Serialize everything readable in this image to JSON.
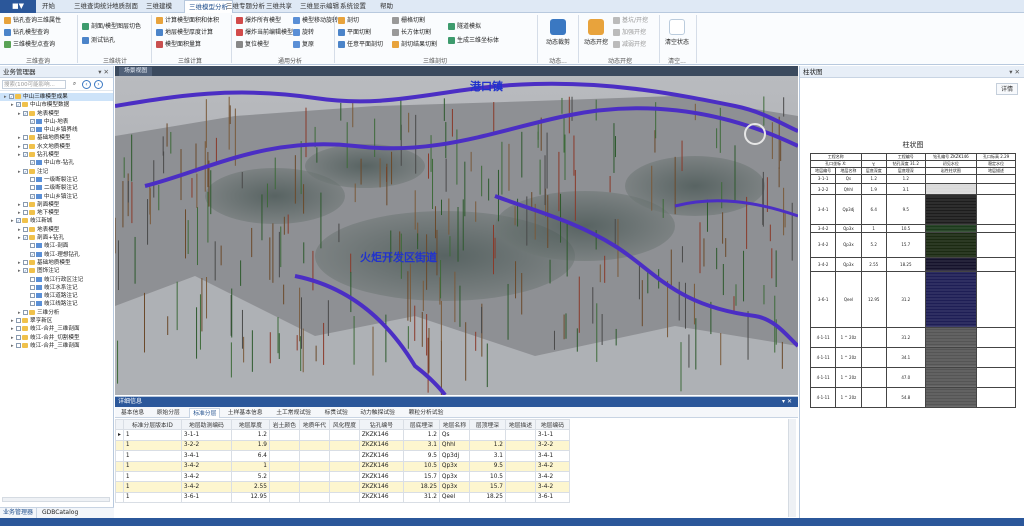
{
  "app": {
    "file_button": "■▼"
  },
  "ribbon_tabs": [
    "开始",
    "三维查询统计",
    "地质剖面",
    "三维建模",
    "三维模型分析",
    "三维专题分析",
    "三维共享",
    "三维显示编辑",
    "系统设置",
    "帮助"
  ],
  "ribbon_active_tab": "三维模型分析",
  "ribbon_groups": [
    {
      "name": "三维查询",
      "items": [
        "钻孔查询三维属性",
        "钻孔模型查询",
        "三维模型点查询"
      ]
    },
    {
      "name": "三维统计",
      "items": [
        "剖面/模型图层切色",
        "测试钻孔"
      ]
    },
    {
      "name": "三维计算",
      "items": [
        "计算模型面积和体积",
        "地层模型厚度计算",
        "模型面积量算"
      ]
    },
    {
      "name": "通用分析",
      "items": [
        "爆炸所有模型",
        "爆炸当前编辑模型",
        "复位模型",
        "模型移动旋转",
        "旋转",
        "复原"
      ]
    },
    {
      "name": "三维剖切",
      "items": [
        "剖切",
        "栅格切割",
        "隧道模拟",
        "平面切割",
        "长方体切割",
        "生成三维坐标体",
        "任意平面剖切",
        "剖切结果切割"
      ]
    },
    {
      "name": "动态...",
      "items": [
        "动态裁剪"
      ]
    },
    {
      "name": "动态开挖",
      "items": [
        "动态开挖",
        "基坑/开挖",
        "加强开挖",
        "减弱开挖"
      ]
    },
    {
      "name": "清空...",
      "items": [
        "清空状态"
      ]
    }
  ],
  "left_panel": {
    "title": "业务管理器",
    "search_placeholder": "搜索(100可能影响...",
    "footer_tabs": [
      "业务管理器",
      "GDBCatalog"
    ],
    "tree": [
      {
        "label": "中山三维模型成果",
        "level": 0,
        "type": "folder",
        "checked": true,
        "selected": true
      },
      {
        "label": "中山市模型数据",
        "level": 1,
        "type": "folder",
        "checked": true
      },
      {
        "label": "地表模型",
        "level": 2,
        "type": "folder",
        "checked": true
      },
      {
        "label": "中山-地表",
        "level": 3,
        "type": "layer",
        "checked": true
      },
      {
        "label": "中山乡镇界线",
        "level": 3,
        "type": "layer",
        "checked": true
      },
      {
        "label": "基础地质模型",
        "level": 2,
        "type": "folder",
        "checked": false
      },
      {
        "label": "水文地质模型",
        "level": 2,
        "type": "folder",
        "checked": false
      },
      {
        "label": "钻孔模型",
        "level": 2,
        "type": "folder",
        "checked": true
      },
      {
        "label": "中山市-钻孔",
        "level": 3,
        "type": "layer",
        "checked": true
      },
      {
        "label": "注记",
        "level": 2,
        "type": "folder",
        "checked": true
      },
      {
        "label": "一级断裂注记",
        "level": 3,
        "type": "layer",
        "checked": false
      },
      {
        "label": "二级断裂注记",
        "level": 3,
        "type": "layer",
        "checked": false
      },
      {
        "label": "中山乡镇注记",
        "level": 3,
        "type": "layer",
        "checked": true
      },
      {
        "label": "剖面模型",
        "level": 2,
        "type": "folder",
        "checked": false
      },
      {
        "label": "地下模型",
        "level": 2,
        "type": "folder",
        "checked": false
      },
      {
        "label": "岐江新城",
        "level": 1,
        "type": "folder",
        "checked": true
      },
      {
        "label": "地表模型",
        "level": 2,
        "type": "folder",
        "checked": false
      },
      {
        "label": "剖面+钻孔",
        "level": 2,
        "type": "folder",
        "checked": true
      },
      {
        "label": "岐江-剖面",
        "level": 3,
        "type": "layer",
        "checked": false
      },
      {
        "label": "岐江-理想钻孔",
        "level": 3,
        "type": "layer",
        "checked": true
      },
      {
        "label": "基础地质模型",
        "level": 2,
        "type": "folder",
        "checked": false
      },
      {
        "label": "图饰注记",
        "level": 2,
        "type": "folder",
        "checked": true
      },
      {
        "label": "岐江行政区注记",
        "level": 3,
        "type": "layer",
        "checked": false
      },
      {
        "label": "岐江水系注记",
        "level": 3,
        "type": "layer",
        "checked": false
      },
      {
        "label": "岐江道路注记",
        "level": 3,
        "type": "layer",
        "checked": false
      },
      {
        "label": "岐江线路注记",
        "level": 3,
        "type": "layer",
        "checked": false
      },
      {
        "label": "三维分析",
        "level": 2,
        "type": "folder",
        "checked": false
      },
      {
        "label": "翠亨新区",
        "level": 1,
        "type": "folder",
        "checked": false
      },
      {
        "label": "岐江-合并_三维剖面",
        "level": 1,
        "type": "folder",
        "checked": false
      },
      {
        "label": "岐江-合并_切割模型",
        "level": 1,
        "type": "folder",
        "checked": false
      },
      {
        "label": "岐江-合并_三维剖面",
        "level": 1,
        "type": "folder",
        "checked": false
      }
    ]
  },
  "viewport": {
    "tab_title": "场景视图",
    "labels": [
      {
        "text": "港口镇"
      },
      {
        "text": "火炬开发区街道"
      }
    ]
  },
  "detail": {
    "title": "详细信息",
    "tabs": [
      "基本信息",
      "原始分层",
      "标准分层",
      "土样基本信息",
      "土工常规试验",
      "标贯试验",
      "动力触探试验",
      "颗粒分析试验"
    ],
    "active_tab": "标准分层",
    "columns": [
      "标准分层版本ID",
      "地层助测编码",
      "地层厚度",
      "岩土颜色",
      "地质年代",
      "风化程度",
      "钻孔编号",
      "层底埋深",
      "地层名称",
      "层顶埋深",
      "地层描述",
      "地层编码"
    ],
    "rows": [
      [
        "1",
        "3-1-1",
        "1.2",
        "",
        "",
        "",
        "ZKZK146",
        "1.2",
        "Qs",
        "",
        "",
        "3-1-1"
      ],
      [
        "1",
        "3-2-2",
        "1.9",
        "",
        "",
        "",
        "ZKZK146",
        "3.1",
        "Qhhl",
        "1.2",
        "",
        "3-2-2"
      ],
      [
        "1",
        "3-4-1",
        "6.4",
        "",
        "",
        "",
        "ZKZK146",
        "9.5",
        "Qp3dj",
        "3.1",
        "",
        "3-4-1"
      ],
      [
        "1",
        "3-4-2",
        "1",
        "",
        "",
        "",
        "ZKZK146",
        "10.5",
        "Qp3x",
        "9.5",
        "",
        "3-4-2"
      ],
      [
        "1",
        "3-4-2",
        "5.2",
        "",
        "",
        "",
        "ZKZK146",
        "15.7",
        "Qp3x",
        "10.5",
        "",
        "3-4-2"
      ],
      [
        "1",
        "3-4-2",
        "2.55",
        "",
        "",
        "",
        "ZKZK146",
        "18.25",
        "Qp3x",
        "15.7",
        "",
        "3-4-2"
      ],
      [
        "1",
        "3-6-1",
        "12.95",
        "",
        "",
        "",
        "ZKZK146",
        "31.2",
        "Qeel",
        "18.25",
        "",
        "3-6-1"
      ]
    ],
    "highlight_rows": [
      1,
      3,
      5
    ]
  },
  "right_panel": {
    "title": "柱状图",
    "details_button": "详情",
    "column_title": "柱状图",
    "header_row1": [
      "工程名称",
      "",
      "工程编号",
      "",
      "钻孔编号",
      "ZKZK146",
      "孔口标高",
      "2.29"
    ],
    "header_row2": [
      "孔口坐标",
      "X:",
      "",
      "Y:",
      "",
      "钻孔深度",
      "31.2",
      "初见水位",
      "",
      "稳定水位",
      ""
    ],
    "col_headers": [
      "地层编号",
      "地层名称",
      "层底深度",
      "层底埋深",
      "岩性柱状图",
      "地层描述"
    ],
    "strata": [
      {
        "code": "3-1-1",
        "name": "Qs",
        "depth": "1.2",
        "bottom": "1.2",
        "fill": "#ffffff"
      },
      {
        "code": "3-2-2",
        "name": "Qhhl",
        "depth": "1.9",
        "bottom": "3.1",
        "fill": "#d9d9d9"
      },
      {
        "code": "3-4-1",
        "name": "Qp3dj",
        "depth": "6.4",
        "bottom": "9.5",
        "fill": "#1d1d1d"
      },
      {
        "code": "3-4-2",
        "name": "Qp3x",
        "depth": "1",
        "bottom": "10.5",
        "fill": "#1b3a1b"
      },
      {
        "code": "3-4-2",
        "name": "Qp3x",
        "depth": "5.2",
        "bottom": "15.7",
        "fill": "#1b2a12"
      },
      {
        "code": "3-4-2",
        "name": "Qp3x",
        "depth": "2.55",
        "bottom": "18.25",
        "fill": "#15122b"
      },
      {
        "code": "3-6-1",
        "name": "Qeel",
        "depth": "12.95",
        "bottom": "31.2",
        "fill": "#1e1e55"
      },
      {
        "code": "4-1-11",
        "name": "1 ^ 20z",
        "depth": "",
        "bottom": "31.2",
        "fill": "#555"
      },
      {
        "code": "4-1-11",
        "name": "1 ^ 20z",
        "depth": "",
        "bottom": "34.1",
        "fill": "#555"
      },
      {
        "code": "4-1-11",
        "name": "1 ^ 20z",
        "depth": "",
        "bottom": "47.0",
        "fill": "#555"
      },
      {
        "code": "4-1-11",
        "name": "1 ^ 20z",
        "depth": "",
        "bottom": "54.8",
        "fill": "#555"
      }
    ]
  },
  "colors": {
    "accent": "#2b579a",
    "ribbon_bg": "#fafcfe",
    "panel_header": "#e7eef7",
    "boundary": "#4b2ec4",
    "highlight": "#fdf6cf"
  }
}
